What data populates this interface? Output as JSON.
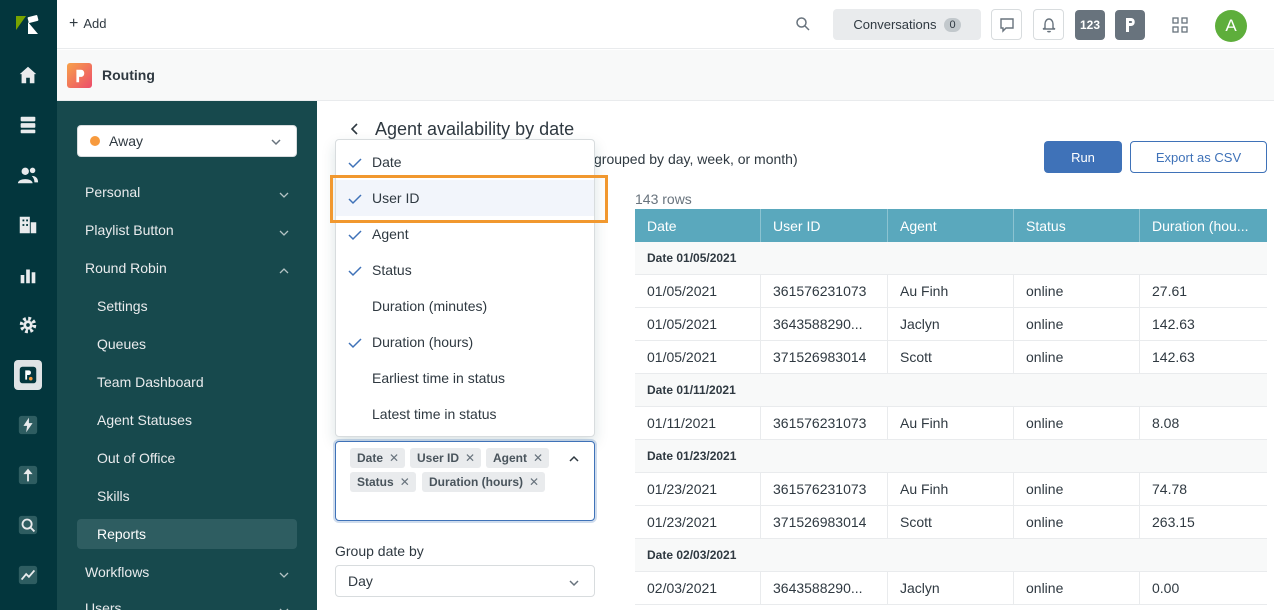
{
  "topbar": {
    "add_label": "Add",
    "conversations_label": "Conversations",
    "conversations_count": "0",
    "badge_number": "123",
    "avatar_initial": "A"
  },
  "app": {
    "title": "Routing"
  },
  "sidebar": {
    "status": "Away",
    "status_color": "#f79a3e",
    "items": [
      {
        "label": "Personal"
      },
      {
        "label": "Playlist Button"
      },
      {
        "label": "Round Robin"
      },
      {
        "label": "Settings"
      },
      {
        "label": "Queues"
      },
      {
        "label": "Team Dashboard"
      },
      {
        "label": "Agent Statuses"
      },
      {
        "label": "Out of Office"
      },
      {
        "label": "Skills"
      },
      {
        "label": "Reports"
      },
      {
        "label": "Workflows"
      },
      {
        "label": "Users"
      }
    ]
  },
  "main": {
    "title": "Agent availability by date",
    "description_fragment": "grouped by day, week, or month)",
    "run_label": "Run",
    "export_label": "Export as CSV",
    "row_count": "143 rows",
    "column_menu": [
      {
        "label": "Date",
        "checked": true
      },
      {
        "label": "User ID",
        "checked": true
      },
      {
        "label": "Agent",
        "checked": true
      },
      {
        "label": "Status",
        "checked": true
      },
      {
        "label": "Duration (minutes)",
        "checked": false
      },
      {
        "label": "Duration (hours)",
        "checked": true
      },
      {
        "label": "Earliest time in status",
        "checked": false
      },
      {
        "label": "Latest time in status",
        "checked": false
      }
    ],
    "selected_columns": [
      "Date",
      "User ID",
      "Agent",
      "Status",
      "Duration (hours)"
    ],
    "group_date_label": "Group date by",
    "group_date_value": "Day"
  },
  "table": {
    "headers": [
      "Date",
      "User ID",
      "Agent",
      "Status",
      "Duration (hou..."
    ],
    "groups": [
      {
        "label": "Date 01/05/2021",
        "rows": [
          [
            "01/05/2021",
            "361576231073",
            "Au Finh",
            "online",
            "27.61"
          ],
          [
            "01/05/2021",
            "3643588290...",
            "Jaclyn",
            "online",
            "142.63"
          ],
          [
            "01/05/2021",
            "371526983014",
            "Scott",
            "online",
            "142.63"
          ]
        ]
      },
      {
        "label": "Date 01/11/2021",
        "rows": [
          [
            "01/11/2021",
            "361576231073",
            "Au Finh",
            "online",
            "8.08"
          ]
        ]
      },
      {
        "label": "Date 01/23/2021",
        "rows": [
          [
            "01/23/2021",
            "361576231073",
            "Au Finh",
            "online",
            "74.78"
          ],
          [
            "01/23/2021",
            "371526983014",
            "Scott",
            "online",
            "263.15"
          ]
        ]
      },
      {
        "label": "Date 02/03/2021",
        "rows": [
          [
            "02/03/2021",
            "3643588290...",
            "Jaclyn",
            "online",
            "0.00"
          ]
        ]
      }
    ]
  }
}
